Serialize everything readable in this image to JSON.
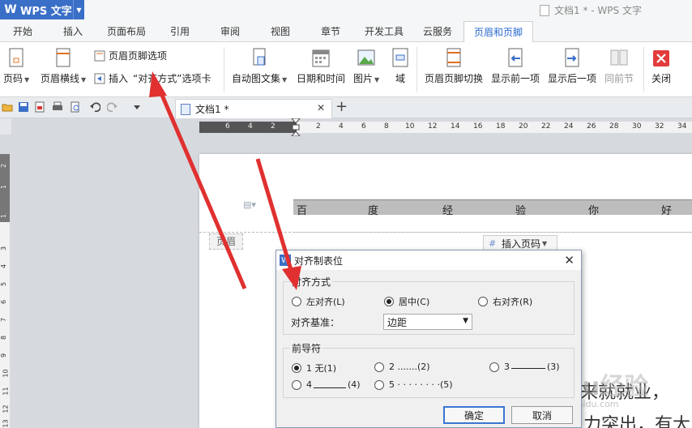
{
  "app": {
    "name": "WPS 文字",
    "window_title": "文档1 * - WPS 文字"
  },
  "menu_tabs": [
    "开始",
    "插入",
    "页面布局",
    "引用",
    "审阅",
    "视图",
    "章节",
    "开发工具",
    "云服务",
    "页眉和页脚"
  ],
  "ribbon": {
    "page_number": "页码",
    "header_line": "页眉横线",
    "header_footer_options": "页眉页脚选项",
    "insert": "插入",
    "align_tab_label": "“对齐方式”选项卡",
    "auto_text": "自动图文集",
    "date_time": "日期和时间",
    "picture": "图片",
    "field": "域",
    "header_footer_switch": "页眉页脚切换",
    "show_previous": "显示前一项",
    "show_next": "显示后一项",
    "same_as_previous": "同前节",
    "close": "关闭"
  },
  "document_tab": {
    "name": "文档1 *"
  },
  "ruler": {
    "h_ticks": [
      "6",
      "4",
      "2",
      "2",
      "4",
      "6",
      "8",
      "10",
      "12",
      "14",
      "16",
      "18",
      "20",
      "22",
      "24",
      "26",
      "28",
      "30",
      "32",
      "34"
    ],
    "v_ticks": [
      "2",
      "1",
      "1",
      "3",
      "4",
      "5",
      "6",
      "7",
      "8",
      "9",
      "10",
      "11",
      "12",
      "13"
    ]
  },
  "page": {
    "header_cells": [
      "百",
      "度",
      "经",
      "验",
      "你",
      "好"
    ],
    "header_label": "页眉",
    "insert_page_number": "插入页码",
    "body_text_1": "来就就业，",
    "body_text_2": "力突出，有大"
  },
  "dialog": {
    "title": "对齐制表位",
    "alignment_group": "对齐方式",
    "align_left": "左对齐(L)",
    "align_center": "居中(C)",
    "align_right": "右对齐(R)",
    "align_selected": "center",
    "basis_label": "对齐基准：",
    "basis_value": "边距",
    "leader_group": "前导符",
    "leader_1": "1 无(1)",
    "leader_2": "2 .......(2)",
    "leader_3_prefix": "3 ",
    "leader_3_suffix": "(3)",
    "leader_4_prefix": "4 ",
    "leader_4_suffix": "(4)",
    "leader_5": "5 · · · · · · · ·(5)",
    "leader_selected": "1",
    "ok": "确定",
    "cancel": "取消"
  },
  "watermark": {
    "brand": "Baidu经验",
    "url": "jingyan.baidu.com"
  },
  "colors": {
    "accent": "#3a6fc8",
    "annotation_red": "#e03030",
    "active_tab_text": "#2a6acc"
  }
}
